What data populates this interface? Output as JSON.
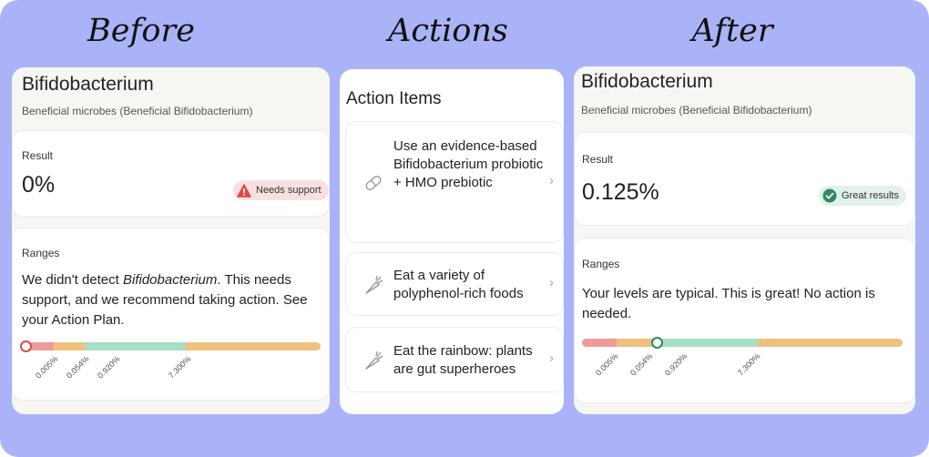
{
  "headings": {
    "before": "Before",
    "actions": "Actions",
    "after": "After"
  },
  "before": {
    "title": "Bifidobacterium",
    "subtitle": "Beneficial microbes (Beneficial Bifidobacterium)",
    "result_label": "Result",
    "result_value": "0%",
    "badge": "Needs support",
    "ranges_label": "Ranges",
    "desc_pre": "We didn't detect ",
    "desc_em": "Bifidobacterium",
    "desc_post": ". This needs support, and we recommend taking action. See your Action Plan.",
    "level": 0.0
  },
  "actions": {
    "title": "Action Items",
    "items": [
      {
        "label": "Use an evidence-based Bifidobacterium probiotic + HMO prebiotic",
        "icon": "pill-icon"
      },
      {
        "label": "Eat a variety of polyphenol-rich foods",
        "icon": "carrot-icon"
      },
      {
        "label": "Eat the rainbow: plants are gut superheroes",
        "icon": "carrot-icon"
      }
    ]
  },
  "after": {
    "title": "Bifidobacterium",
    "subtitle": "Beneficial microbes (Beneficial Bifidobacterium)",
    "result_label": "Result",
    "result_value": "0.125%",
    "badge": "Great results",
    "ranges_label": "Ranges",
    "desc": "Your levels are typical. This is great! No action is needed.",
    "level": 0.125
  },
  "range_ticks": [
    "0.005%",
    "0.054%",
    "0.920%",
    "7.300%"
  ],
  "colors": {
    "background": "#aab3f7",
    "range_low": "#ee9b98",
    "range_mid": "#f0c07e",
    "range_good": "#a7dfc2",
    "needs_support": "#d94a4a",
    "great_results": "#2f8a5f"
  }
}
